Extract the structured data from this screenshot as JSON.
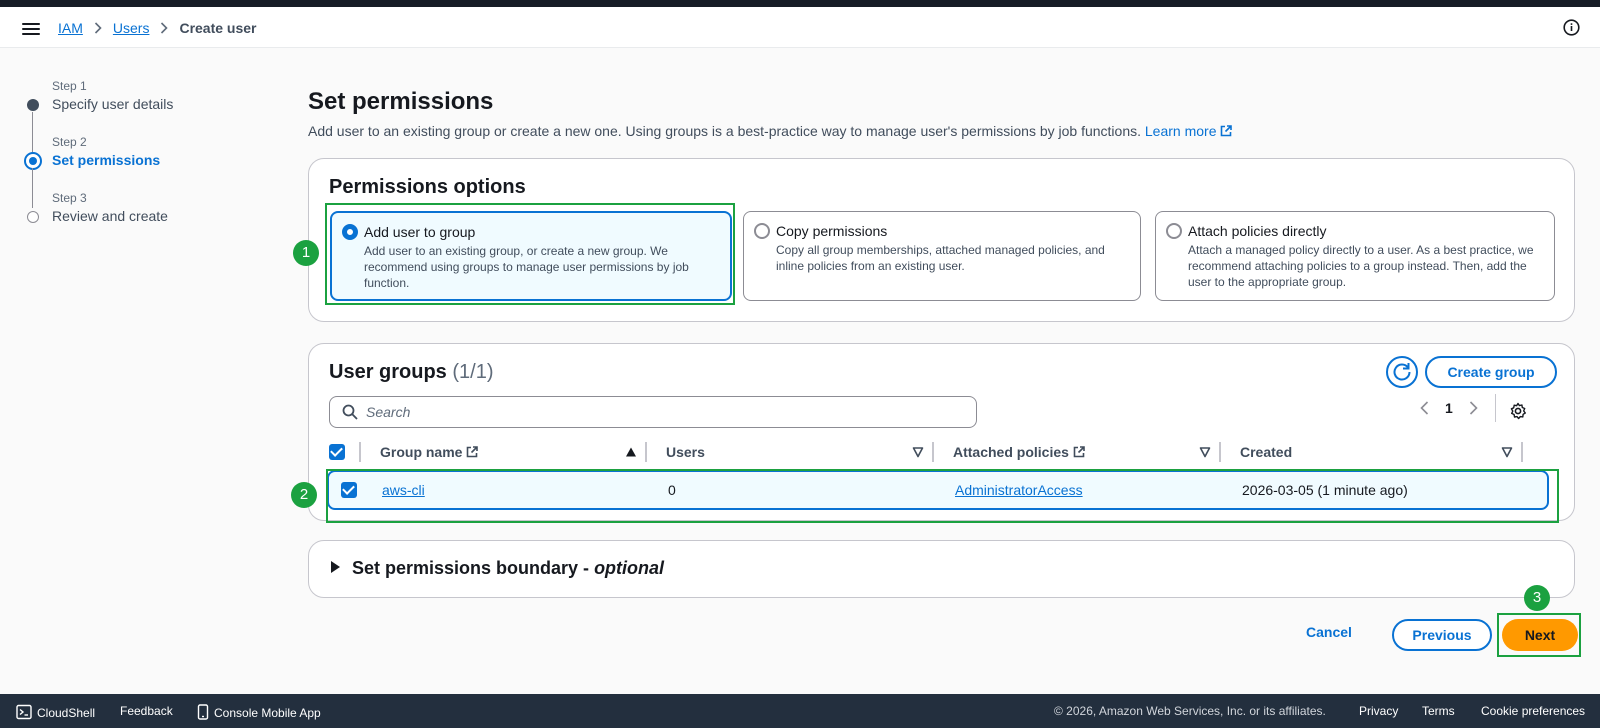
{
  "breadcrumb": {
    "iam": "IAM",
    "users": "Users",
    "current": "Create user"
  },
  "steps": [
    {
      "num": "Step 1",
      "title": "Specify user details"
    },
    {
      "num": "Step 2",
      "title": "Set permissions"
    },
    {
      "num": "Step 3",
      "title": "Review and create"
    }
  ],
  "page": {
    "title": "Set permissions",
    "description": "Add user to an existing group or create a new one. Using groups is a best-practice way to manage user's permissions by job functions.",
    "learn_more": "Learn more"
  },
  "permissions_options": {
    "title": "Permissions options",
    "options": [
      {
        "title": "Add user to group",
        "desc": "Add user to an existing group, or create a new group. We recommend using groups to manage user permissions by job function.",
        "selected": true
      },
      {
        "title": "Copy permissions",
        "desc": "Copy all group memberships, attached managed policies, and inline policies from an existing user.",
        "selected": false
      },
      {
        "title": "Attach policies directly",
        "desc": "Attach a managed policy directly to a user. As a best practice, we recommend attaching policies to a group instead. Then, add the user to the appropriate group.",
        "selected": false
      }
    ]
  },
  "user_groups": {
    "title": "User groups",
    "count": "(1/1)",
    "create_label": "Create group",
    "search_placeholder": "Search",
    "page": "1",
    "columns": [
      "Group name",
      "Users",
      "Attached policies",
      "Created"
    ],
    "rows": [
      {
        "name": "aws-cli",
        "users": "0",
        "policies": "AdministratorAccess",
        "created": "2026-03-05 (1 minute ago)",
        "checked": true
      }
    ]
  },
  "boundary": {
    "title": "Set permissions boundary - ",
    "optional": "optional"
  },
  "actions": {
    "cancel": "Cancel",
    "previous": "Previous",
    "next": "Next"
  },
  "annotations": [
    "1",
    "2",
    "3"
  ],
  "footer": {
    "cloudshell": "CloudShell",
    "feedback": "Feedback",
    "mobile": "Console Mobile App",
    "copyright": "© 2026, Amazon Web Services, Inc. or its affiliates.",
    "privacy": "Privacy",
    "terms": "Terms",
    "cookies": "Cookie preferences"
  },
  "colors": {
    "accent": "#0972d3",
    "primary_button": "#ff9900",
    "annotation": "#1ba140",
    "footer_bg": "#232f3e"
  }
}
